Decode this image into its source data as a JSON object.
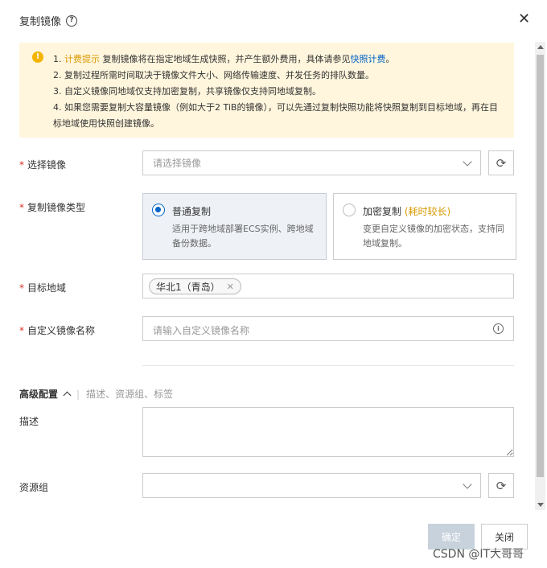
{
  "dialog": {
    "title": "复制镜像",
    "help_icon": "?",
    "close_icon": "✕"
  },
  "notice": {
    "line1_prefix": "1. ",
    "line1_highlight": "计费提示",
    "line1_text": " 复制镜像将在指定地域生成快照，并产生额外费用，具体请参见",
    "line1_link": "快照计费",
    "line1_end": "。",
    "line2": "2. 复制过程所需时间取决于镜像文件大小、网络传输速度、并发任务的排队数量。",
    "line3": "3. 自定义镜像同地域仅支持加密复制，共享镜像仅支持同地域复制。",
    "line4": "4. 如果您需要复制大容量镜像（例如大于2 TiB的镜像），可以先通过复制快照功能将快照复制到目标地域，再在目标地域使用快照创建镜像。"
  },
  "form": {
    "select_image": {
      "label": "选择镜像",
      "placeholder": "请选择镜像"
    },
    "copy_type": {
      "label": "复制镜像类型",
      "options": [
        {
          "title": "普通复制",
          "tag": "",
          "desc": "适用于跨地域部署ECS实例、跨地域备份数据。",
          "selected": true
        },
        {
          "title": "加密复制",
          "tag": "(耗时较长)",
          "desc": "变更自定义镜像的加密状态，支持同地域复制。",
          "selected": false
        }
      ]
    },
    "target_region": {
      "label": "目标地域",
      "value": "华北1（青岛）"
    },
    "custom_name": {
      "label": "自定义镜像名称",
      "placeholder": "请输入自定义镜像名称"
    },
    "required_mark": "*"
  },
  "advanced": {
    "title": "高级配置",
    "separator": "|",
    "hint": "描述、资源组、标签",
    "description": {
      "label": "描述",
      "value": ""
    },
    "resource_group": {
      "label": "资源组",
      "value": ""
    }
  },
  "footer": {
    "ok": "确定",
    "cancel": "关闭"
  },
  "watermark": "CSDN @IT大哥哥",
  "colors": {
    "accent": "#0064c8",
    "warning": "#d89a00",
    "notice_bg": "#fff6dd",
    "required": "#d93026",
    "disabled_button": "#c8d2dc"
  },
  "icons": {
    "refresh": "refresh-icon",
    "chevron": "chevron-down-icon",
    "info": "info-icon",
    "warning": "warning-icon"
  }
}
